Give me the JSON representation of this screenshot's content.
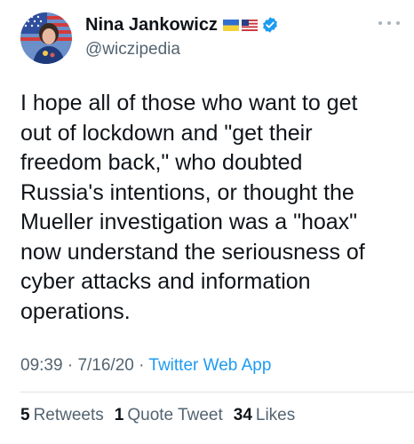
{
  "author": {
    "display_name": "Nina Jankowicz",
    "handle": "@wiczipedia",
    "flags": [
      "ukraine-flag-icon",
      "us-flag-icon"
    ],
    "verified": true
  },
  "tweet": {
    "lines": [
      "I hope all of those who want to get",
      "out of lockdown and \"get their",
      "freedom back,\" who doubted",
      "Russia's intentions, or thought the",
      "Mueller investigation was a \"hoax\"",
      "now understand the seriousness of",
      "cyber attacks and information",
      "operations."
    ]
  },
  "meta": {
    "time": "09:39",
    "sep1": " · ",
    "date": "7/16/20",
    "sep2": " · ",
    "source": "Twitter Web App"
  },
  "stats": {
    "retweets_count": "5",
    "retweets_label": "Retweets",
    "quotes_count": "1",
    "quotes_label": "Quote Tweet",
    "likes_count": "34",
    "likes_label": "Likes"
  },
  "colors": {
    "text": "#0f1419",
    "secondary": "#536471",
    "link": "#1d9bf0",
    "verified": "#1d9bf0"
  }
}
